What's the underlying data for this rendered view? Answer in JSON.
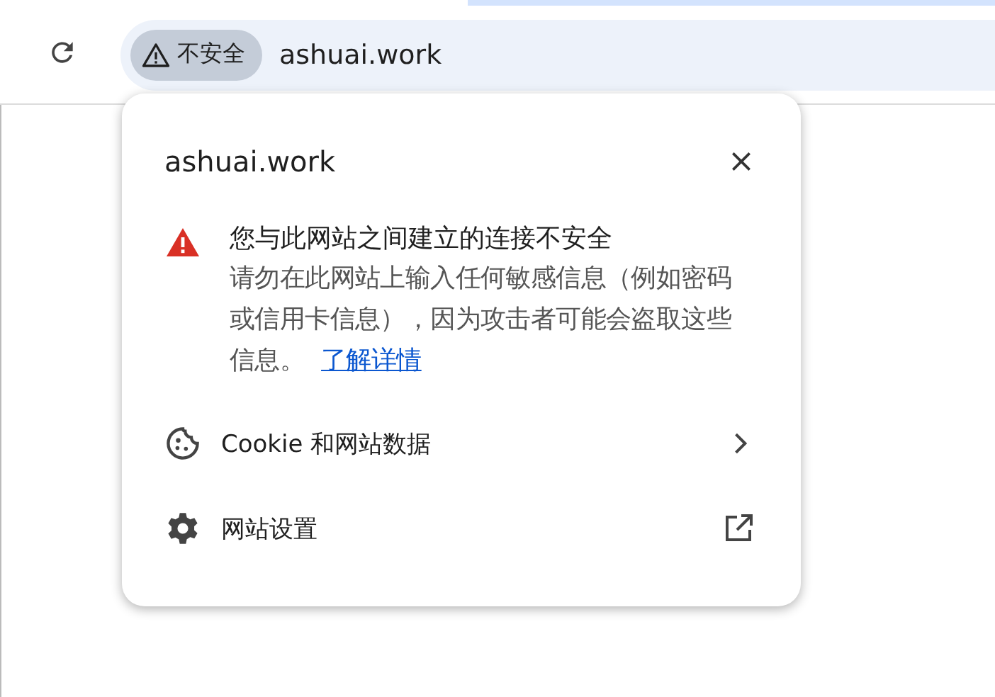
{
  "toolbar": {
    "security_chip": {
      "label": "不安全"
    },
    "url": "ashuai.work"
  },
  "popup": {
    "title": "ashuai.work",
    "warning": {
      "heading": "您与此网站之间建立的连接不安全",
      "body": "请勿在此网站上输入任何敏感信息（例如密码或信用卡信息），因为攻击者可能会盗取这些信息。",
      "link": "了解详情"
    },
    "items": [
      {
        "kind": "submenu",
        "label": "Cookie 和网站数据"
      },
      {
        "kind": "external",
        "label": "网站设置"
      }
    ]
  }
}
